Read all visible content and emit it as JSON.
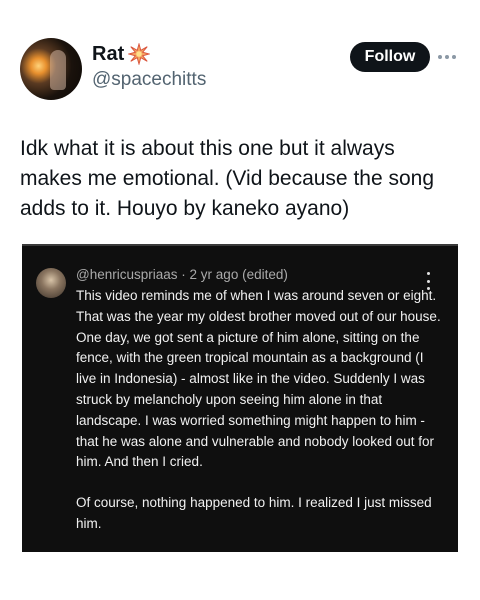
{
  "tweet": {
    "author": {
      "display_name": "Rat",
      "name_emoji": "sparkle-burst-icon",
      "handle": "@spacechitts"
    },
    "follow_label": "Follow",
    "text": "Idk what it is about this one but it always makes me emotional. (Vid because the song adds to it. Houyo by kaneko ayano)"
  },
  "embedded_comment": {
    "username": "@henricuspriaas",
    "separator": "·",
    "time": "2 yr ago (edited)",
    "paragraphs": [
      "This video reminds me of when I was around seven or eight. That was the year my oldest brother moved out of our house. One day, we got sent a picture of him alone, sitting on the fence, with the green tropical mountain as a background (I live in Indonesia) - almost like in the video. Suddenly I was struck by melancholy upon seeing him alone in that landscape. I was worried something might happen to him - that he was alone and vulnerable and nobody looked out for him. And then I cried.",
      "Of course, nothing happened to him. I realized I just missed him."
    ]
  },
  "colors": {
    "follow_bg": "#0f1419",
    "handle": "#536471",
    "embed_bg": "#0f0f0f",
    "comment_text": "#f1f1f1",
    "comment_meta": "#aaaaaa"
  }
}
